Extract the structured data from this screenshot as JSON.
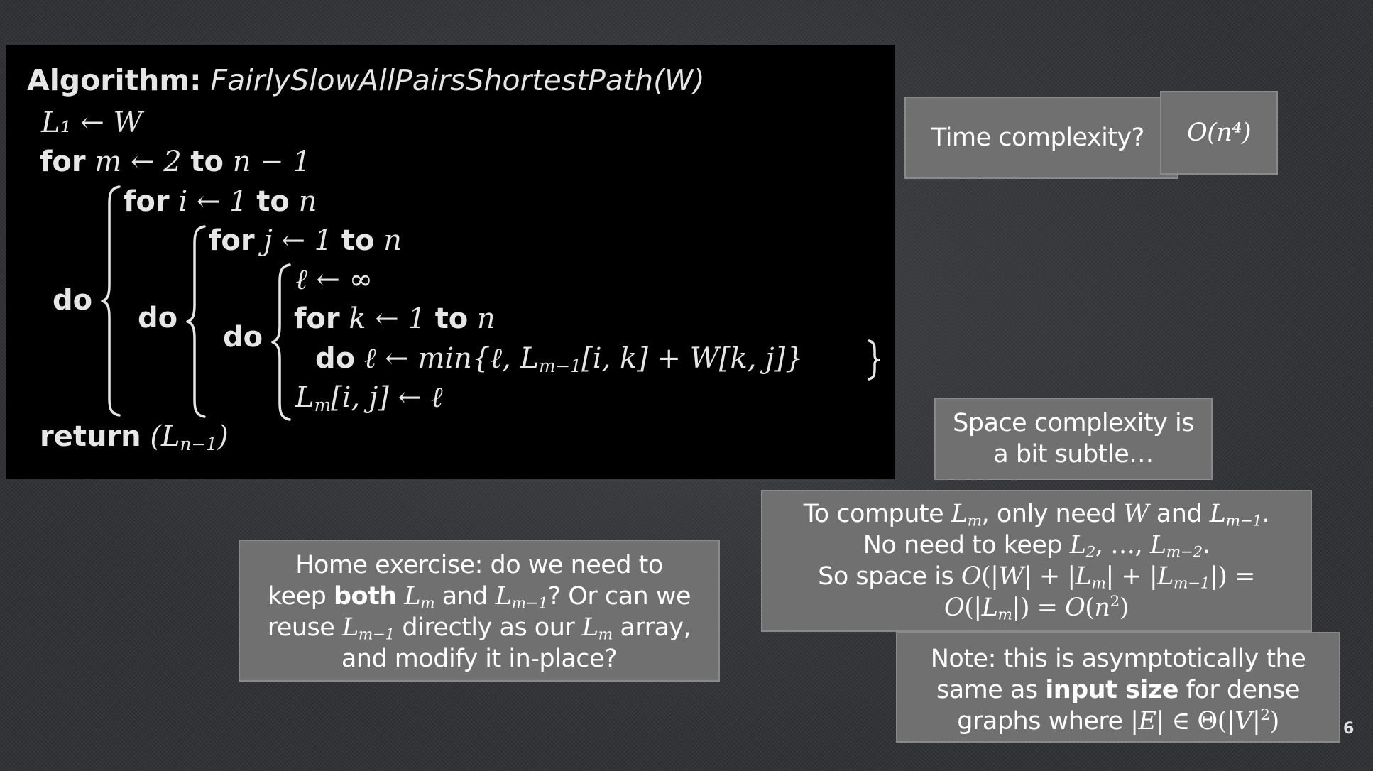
{
  "algorithm": {
    "title_label": "Algorithm:",
    "title_name": "FairlySlowAllPairsShortestPath",
    "title_arg": "(W)",
    "kw_for": "for",
    "kw_to": "to",
    "kw_do": "do",
    "kw_return": "return",
    "line1": "L₁ ← W",
    "loop_m": "m ← 2",
    "loop_m_end": "n − 1",
    "loop_i": "i ← 1",
    "loop_j": "j ← 1",
    "loop_k": "k ← 1",
    "n": "n",
    "init_l": "ℓ ← ∞",
    "update": "ℓ ← min{ℓ, L",
    "update_sub": "m−1",
    "update_tail": "[i, k] + W[k, j]}",
    "assign_L": "L",
    "assign_sub": "m",
    "assign_tail": "[i, j] ← ℓ",
    "return_L": "(L",
    "return_sub": "n−1",
    "return_tail": ")"
  },
  "callouts": {
    "time_question": "Time complexity?",
    "time_answer": "O(n⁴)",
    "space_intro": [
      "Space complexity is",
      "a bit subtle…"
    ],
    "space_detail": {
      "line1": "To compute L_m, only need W and L_{m−1}.",
      "line2": "No need to keep L_2, …, L_{m−2}.",
      "line3": "So space is O(|W| + |L_m| + |L_{m−1}|) =",
      "line4": "O(|L_m|) = O(n²)"
    },
    "note": {
      "line1": "Note: this is asymptotically the",
      "line2_pre": "same as ",
      "line2_bold": "input size",
      "line2_post": " for dense",
      "line3": "graphs where |E| ∈ Θ(|V|²)"
    },
    "exercise": {
      "line1": "Home exercise: do we need to",
      "line2_pre": "keep ",
      "line2_bold": "both",
      "line2_post": " L_m and L_{m−1}? Or can we",
      "line3": "reuse L_{m−1} directly as our L_m array,",
      "line4": "and modify it in-place?"
    }
  },
  "page_number": "6"
}
